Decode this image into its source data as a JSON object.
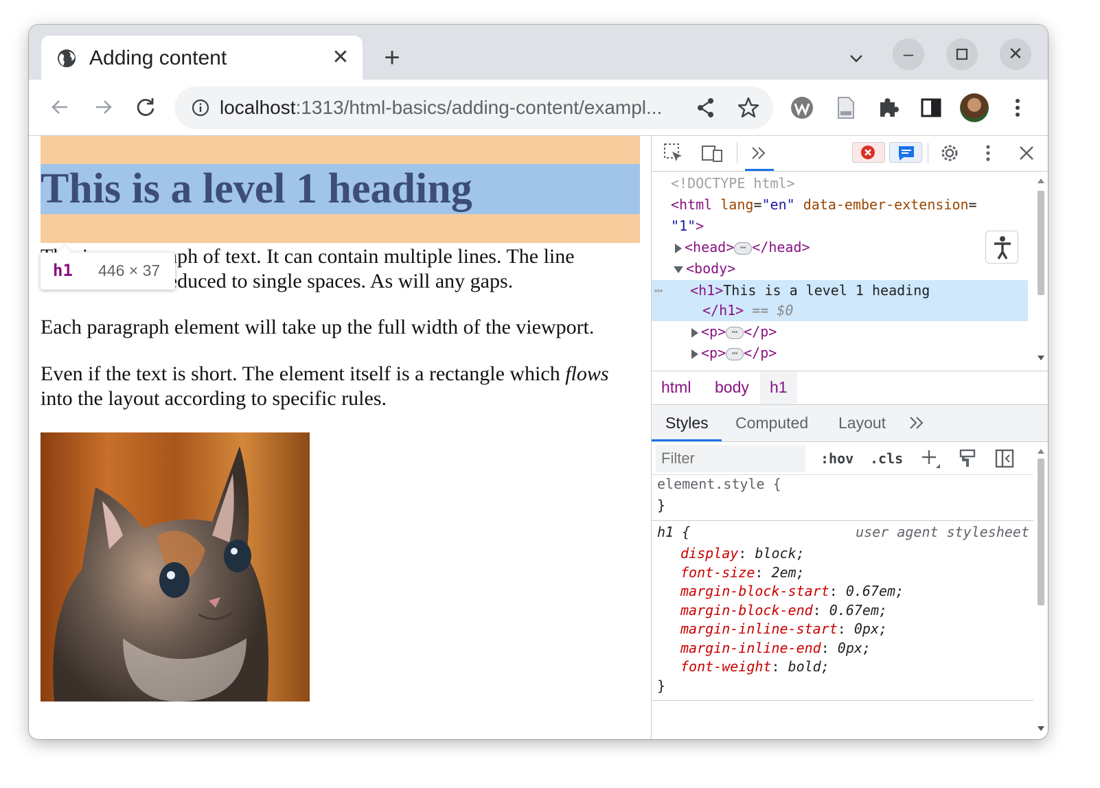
{
  "tab": {
    "title": "Adding content"
  },
  "omnibox": {
    "host": "localhost",
    "path": ":1313/html-basics/adding-content/exampl..."
  },
  "page": {
    "heading": "This is a level 1 heading",
    "p1_line1": "This is a paragraph of text. It can contain multiple lines. The line",
    "p1_line2": "breaks will be reduced to single spaces. As will any gaps.",
    "p2": "Each paragraph element will take up the full width of the viewport.",
    "p3_before": "Even if the text is short. The element itself is a rectangle which ",
    "p3_em": "flows",
    "p3_line2": "into the layout according to specific rules."
  },
  "tooltip": {
    "tag": "h1",
    "dims": "446 × 37"
  },
  "devtools": {
    "elements": {
      "doctype": "<!DOCTYPE html>",
      "html_open": "<html",
      "html_attr1": "lang",
      "html_val1": "\"en\"",
      "html_attr2": "data-ember-extension",
      "html_val2": "\"1\"",
      "head_open": "<head>",
      "head_close": "</head>",
      "body_open": "<body>",
      "h1_open": "<h1>",
      "h1_text": "This is a level 1 heading",
      "h1_close": "</h1>",
      "eq_marker": "== $0",
      "p_open": "<p>",
      "p_close": "</p>",
      "ellipsis": "⋯"
    },
    "breadcrumbs": [
      "html",
      "body",
      "h1"
    ],
    "tabs": [
      "Styles",
      "Computed",
      "Layout"
    ],
    "filter_placeholder": "Filter",
    "hov": ":hov",
    "cls": ".cls",
    "styles": {
      "element_style": "element.style {",
      "close_brace": "}",
      "h1_selector": "h1 {",
      "origin": "user agent stylesheet",
      "declarations": [
        {
          "prop": "display",
          "value": "block;"
        },
        {
          "prop": "font-size",
          "value": "2em;"
        },
        {
          "prop": "margin-block-start",
          "value": "0.67em;"
        },
        {
          "prop": "margin-block-end",
          "value": "0.67em;"
        },
        {
          "prop": "margin-inline-start",
          "value": "0px;"
        },
        {
          "prop": "margin-inline-end",
          "value": "0px;"
        },
        {
          "prop": "font-weight",
          "value": "bold;"
        }
      ]
    }
  },
  "colors": {
    "margin_overlay": "#f9cc9d",
    "content_overlay": "#a0c5e8",
    "devtools_accent": "#1a73e8",
    "tag_color": "#881280"
  }
}
